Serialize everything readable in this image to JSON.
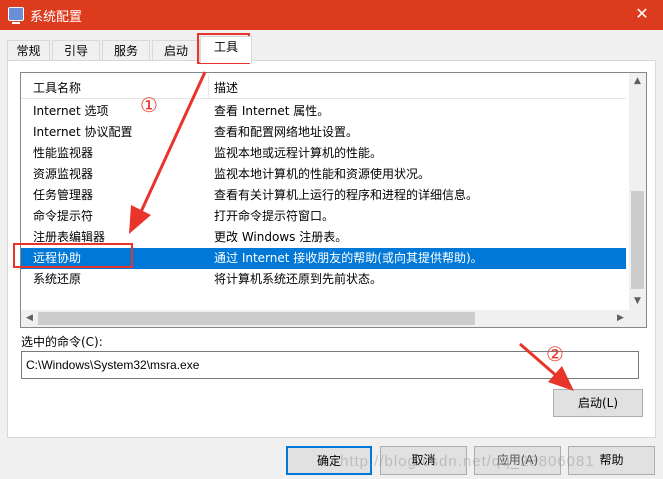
{
  "window": {
    "title": "系统配置",
    "close_glyph": "✕"
  },
  "tabs": [
    {
      "label": "常规"
    },
    {
      "label": "引导"
    },
    {
      "label": "服务"
    },
    {
      "label": "启动"
    },
    {
      "label": "工具"
    }
  ],
  "tools": {
    "col_name": "工具名称",
    "col_desc": "描述",
    "rows": [
      {
        "name": "Internet 选项",
        "desc": "查看 Internet 属性。"
      },
      {
        "name": "Internet 协议配置",
        "desc": "查看和配置网络地址设置。"
      },
      {
        "name": "性能监视器",
        "desc": "监视本地或远程计算机的性能。"
      },
      {
        "name": "资源监视器",
        "desc": "监视本地计算机的性能和资源使用状况。"
      },
      {
        "name": "任务管理器",
        "desc": "查看有关计算机上运行的程序和进程的详细信息。"
      },
      {
        "name": "命令提示符",
        "desc": "打开命令提示符窗口。"
      },
      {
        "name": "注册表编辑器",
        "desc": "更改 Windows 注册表。"
      },
      {
        "name": "远程协助",
        "desc": "通过 Internet 接收朋友的帮助(或向其提供帮助)。"
      },
      {
        "name": "系统还原",
        "desc": "将计算机系统还原到先前状态。"
      }
    ],
    "selected_index": 7
  },
  "command": {
    "label": "选中的命令(C):",
    "value": "C:\\Windows\\System32\\msra.exe",
    "launch_label": "启动(L)"
  },
  "footer": {
    "ok": "确定",
    "cancel": "取消",
    "apply": "应用(A)",
    "help": "帮助"
  },
  "annotations": {
    "step1": "①",
    "step2": "②",
    "color": "#e8342a"
  },
  "watermark": "http://blog.csdn.net/qq_28806081"
}
